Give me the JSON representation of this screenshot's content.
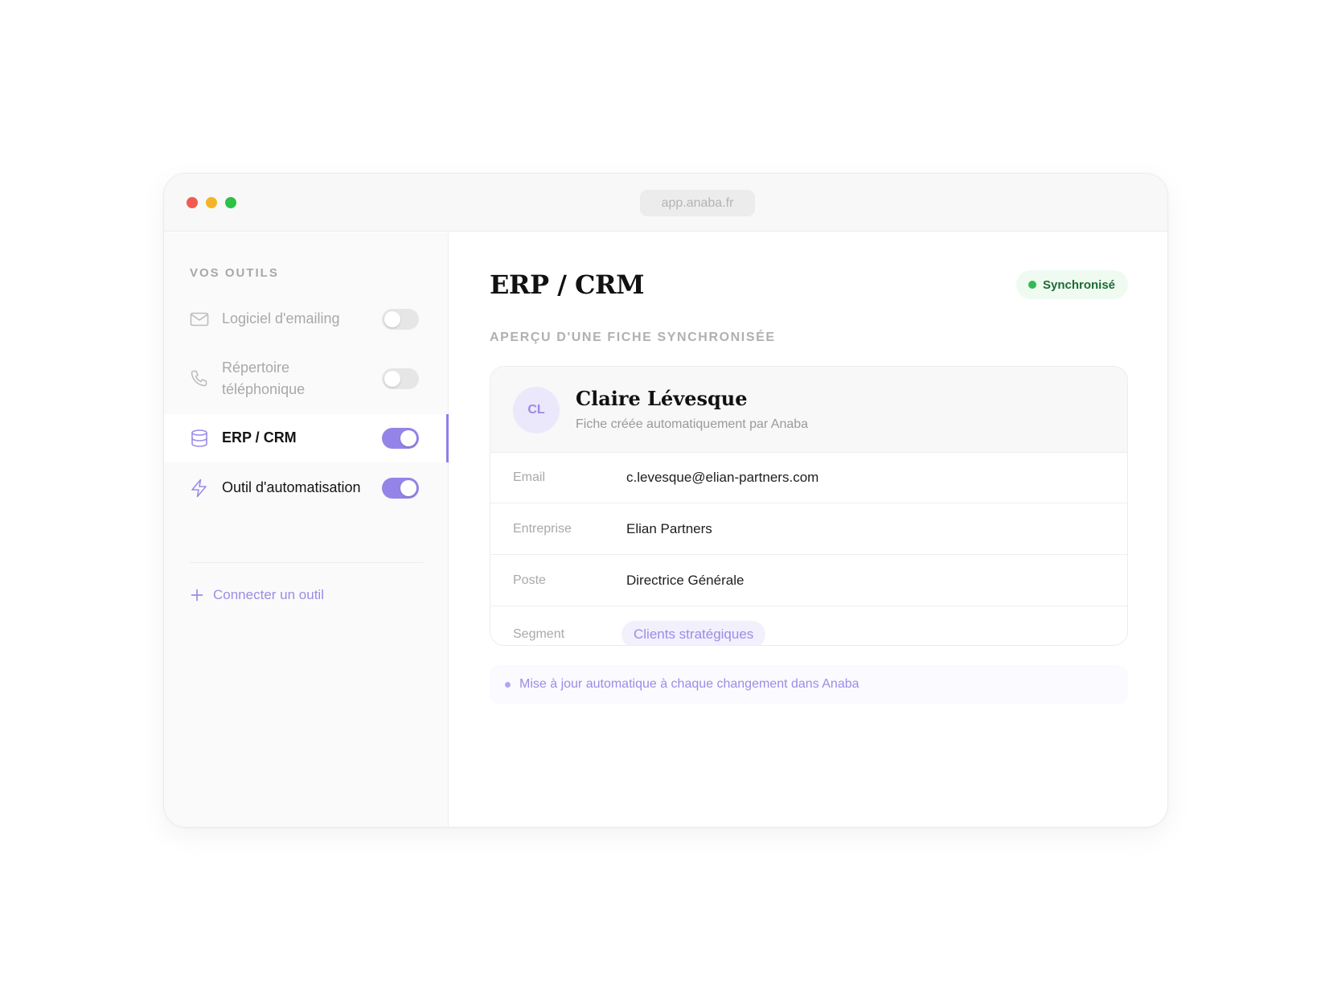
{
  "window": {
    "url": "app.anaba.fr"
  },
  "sidebar": {
    "heading": "VOS OUTILS",
    "tools": [
      {
        "label": "Logiciel d'emailing",
        "icon": "mail-icon",
        "enabled": false,
        "active": false
      },
      {
        "label_line1": "Répertoire",
        "label_line2": "téléphonique",
        "icon": "phone-icon",
        "enabled": false,
        "active": false
      },
      {
        "label": "ERP / CRM",
        "icon": "database-icon",
        "enabled": true,
        "active": true
      },
      {
        "label": "Outil d'automatisation",
        "icon": "lightning-icon",
        "enabled": true,
        "active": false
      }
    ],
    "connect_label": "Connecter un outil"
  },
  "main": {
    "title": "ERP / CRM",
    "status": "Synchronisé",
    "section_label": "APERÇU D'UNE FICHE SYNCHRONISÉE",
    "record": {
      "initials": "CL",
      "name": "Claire Lévesque",
      "subtitle": "Fiche créée automatiquement par Anaba",
      "fields": [
        {
          "label": "Email",
          "value": "c.levesque@elian-partners.com"
        },
        {
          "label": "Entreprise",
          "value": "Elian Partners"
        },
        {
          "label": "Poste",
          "value": "Directrice Générale"
        },
        {
          "label": "Segment",
          "value": "Clients stratégiques"
        }
      ]
    },
    "note": "Mise à jour automatique à chaque changement dans Anaba"
  },
  "colors": {
    "accent": "#9484e8",
    "status_green": "#35b956",
    "close": "#f25a51",
    "minimize": "#f5b428",
    "maximize": "#2cc245"
  }
}
